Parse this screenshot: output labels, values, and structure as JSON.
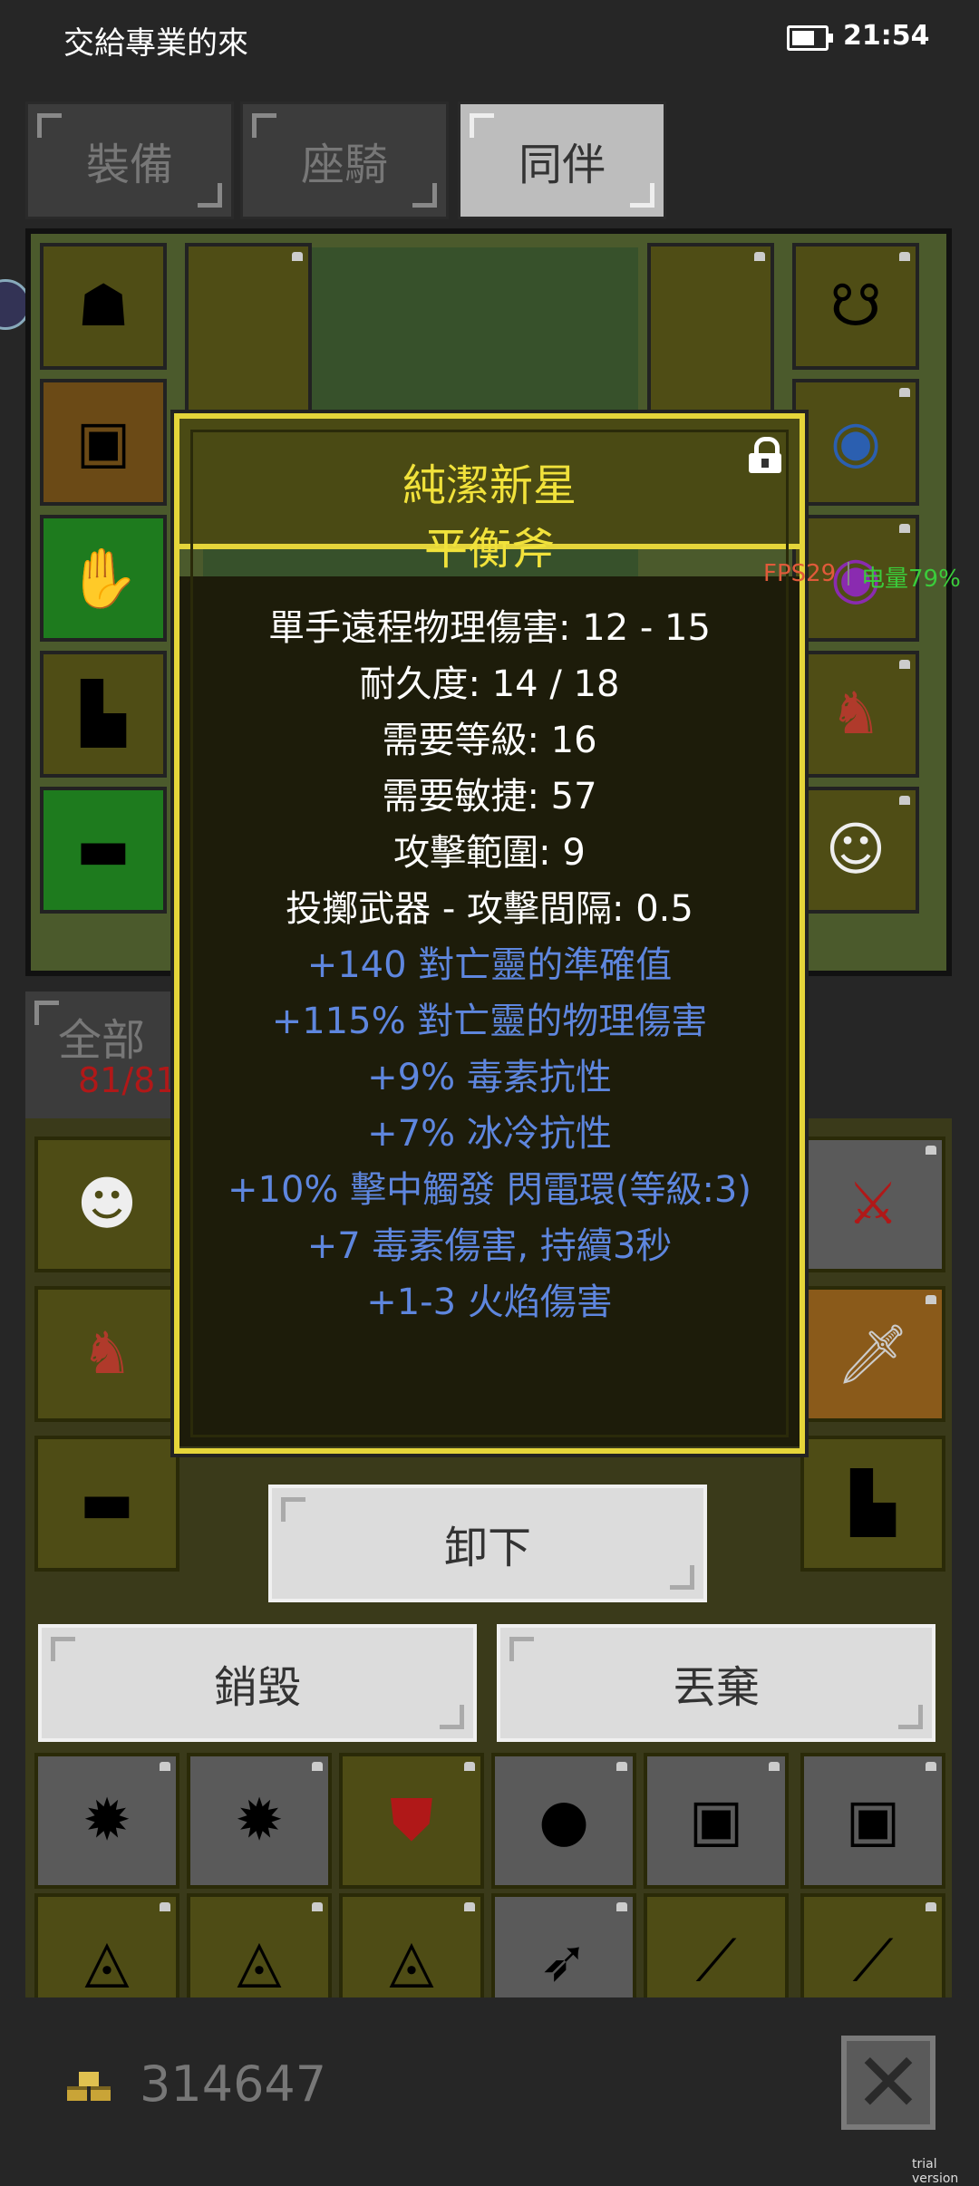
{
  "status_bar": {
    "title": "交給專業的來",
    "time": "21:54"
  },
  "tabs": [
    {
      "label": "裝備"
    },
    {
      "label": "座騎"
    },
    {
      "label": "同伴"
    }
  ],
  "filter": {
    "label": "全部",
    "count": "81/81"
  },
  "tooltip": {
    "name": "純潔新星",
    "type": "平衡斧",
    "stats": [
      "單手遠程物理傷害: 12 - 15",
      "耐久度: 14 / 18",
      "需要等級: 16",
      "需要敏捷: 57",
      "攻擊範圍: 9",
      "投擲武器 - 攻擊間隔: 0.5"
    ],
    "magic": [
      "+140 對亡靈的準確值",
      "+115% 對亡靈的物理傷害",
      "+9% 毒素抗性",
      "+7% 冰冷抗性",
      "+10% 擊中觸發 閃電環(等級:3)",
      "+7 毒素傷害, 持續3秒",
      "+1-3 火焰傷害"
    ]
  },
  "overlay": {
    "fps": "FPS29",
    "battery": "电量79%"
  },
  "buttons": {
    "unequip": "卸下",
    "destroy": "銷毀",
    "drop": "丟棄"
  },
  "gold": "314647",
  "close_icon": "✕",
  "watermark": "trial version",
  "colors": {
    "tooltip_border": "#e5d53a",
    "title": "#f1e23b",
    "magic_text": "#5e86de",
    "accent_red": "#b01818"
  }
}
